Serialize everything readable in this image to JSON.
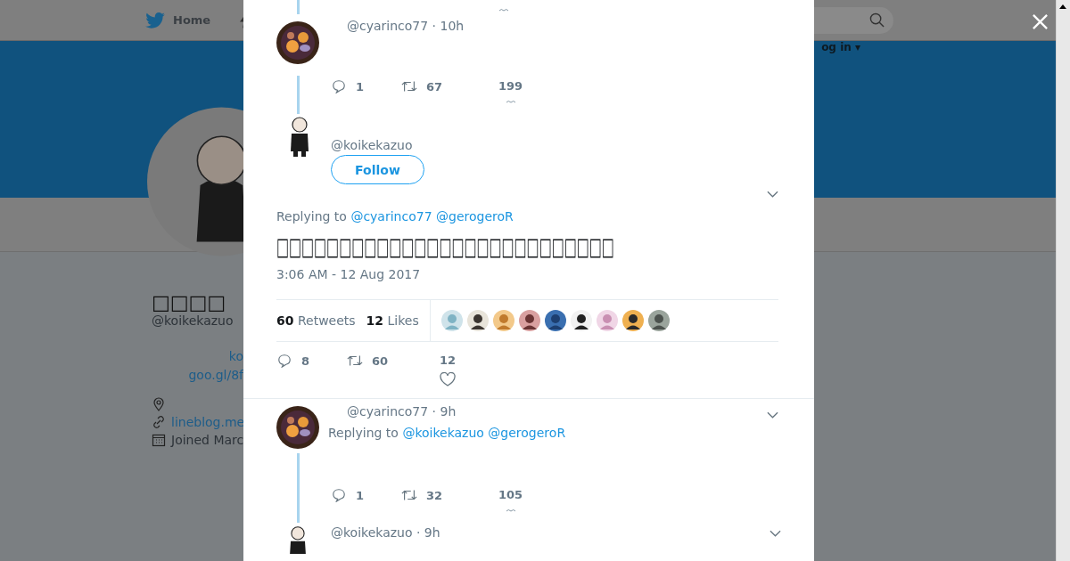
{
  "nav": {
    "home": "Home",
    "login": "og in ▾"
  },
  "profile": {
    "name": "□□□□",
    "handle": "@koikekazuo",
    "bio_lines": [
      "ko",
      "goo.gl/8f"
    ],
    "link": "lineblog.me",
    "joined": "Joined Marc"
  },
  "thread": {
    "parent": {
      "meta": "@cyarinco77 · 10h",
      "replies": "1",
      "retweets": "67",
      "likes": "199"
    },
    "main": {
      "handle": "@koikekazuo",
      "follow": "Follow",
      "replying_label": "Replying to",
      "replying_to": [
        "@cyarinco77",
        "@gerogeroR"
      ],
      "text": "□□□□□□□□□□□□□□□□□□□□□□□□□□□",
      "timestamp": "3:06 AM - 12 Aug 2017",
      "retweets_count": "60",
      "retweets_label": "Retweets",
      "likes_count": "12",
      "likes_label": "Likes",
      "replies": "8",
      "retweets": "60",
      "likes": "12"
    },
    "reply": {
      "meta": "@cyarinco77 · 9h",
      "replying_label": "Replying to",
      "replying_to": [
        "@koikekazuo",
        "@gerogeroR"
      ],
      "replies": "1",
      "retweets": "32",
      "likes": "105"
    },
    "next": {
      "meta": "@koikekazuo · 9h"
    }
  }
}
